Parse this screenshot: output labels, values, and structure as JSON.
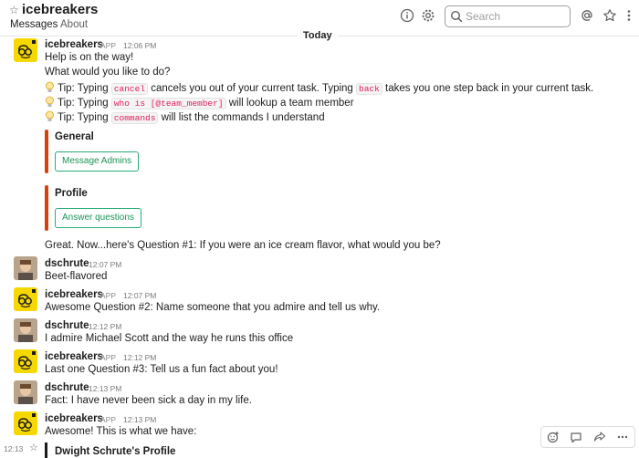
{
  "header": {
    "channel_name": "icebreakers",
    "tabs": [
      "Messages",
      "About"
    ],
    "search_placeholder": "Search",
    "icons": [
      "info-icon",
      "gear-icon",
      "search-icon",
      "at-icon",
      "star-icon",
      "more-icon"
    ]
  },
  "day_divider": "Today",
  "messages": [
    {
      "sender": "icebreakers",
      "badge": "APP",
      "time": "12:06 PM",
      "lines": [
        "Help is on the way!",
        "What would you like to do?"
      ],
      "tips": [
        {
          "pre": "Tip: Typing ",
          "code": "cancel",
          "post": " cancels you out of your current task. Typing ",
          "code2": "back",
          "post2": " takes you one step back in your current task."
        },
        {
          "pre": "Tip: Typing ",
          "code": "who is [@team_member]",
          "post": " will lookup a team member"
        },
        {
          "pre": "Tip: Typing ",
          "code": "commands",
          "post": " will list the commands I understand"
        }
      ],
      "attachments": [
        {
          "title": "General",
          "button": "Message Admins"
        },
        {
          "title": "Profile",
          "button": "Answer questions"
        }
      ],
      "followup": "Great. Now...here's Question #1: If you were an ice cream flavor, what would you be?"
    },
    {
      "sender": "dschrute",
      "time": "12:07 PM",
      "text": "Beet-flavored"
    },
    {
      "sender": "icebreakers",
      "badge": "APP",
      "time": "12:07 PM",
      "text": "Awesome Question #2: Name someone that you admire and tell us why."
    },
    {
      "sender": "dschrute",
      "time": "12:12 PM",
      "text": "I admire Michael Scott and the way he runs this office"
    },
    {
      "sender": "icebreakers",
      "badge": "APP",
      "time": "12:12 PM",
      "text": "Last one Question #3: Tell us a fun fact about you!"
    },
    {
      "sender": "dschrute",
      "time": "12:13 PM",
      "text": "Fact: I have never been sick a day in my life."
    },
    {
      "sender": "icebreakers",
      "badge": "APP",
      "time": "12:13 PM",
      "text": "Awesome! This is what we have:"
    }
  ],
  "hover_time": "12:13",
  "profile_title": "Dwight Schrute's Profile",
  "colors": {
    "accent_bar": "#d93f0b",
    "button_green": "#2bac76",
    "code_red": "#e01e5a",
    "bot_avatar": "#f5d800"
  }
}
